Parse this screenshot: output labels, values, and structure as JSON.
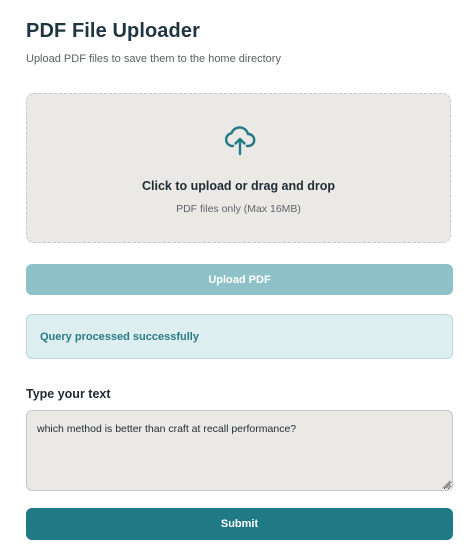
{
  "header": {
    "title": "PDF File Uploader",
    "subtitle": "Upload PDF files to save them to the home directory"
  },
  "dropzone": {
    "icon": "cloud-upload-icon",
    "title": "Click to upload or drag and drop",
    "hint": "PDF files only (Max 16MB)"
  },
  "upload_button": {
    "label": "Upload PDF"
  },
  "status": {
    "message": "Query processed successfully"
  },
  "query": {
    "label": "Type your text",
    "value": "which method is better than craft at recall performance?"
  },
  "submit_button": {
    "label": "Submit"
  },
  "colors": {
    "accent": "#1f7a86",
    "accent_light": "#8fc1c8",
    "status_bg": "#ddeef0",
    "surface": "#ebe9e6"
  }
}
